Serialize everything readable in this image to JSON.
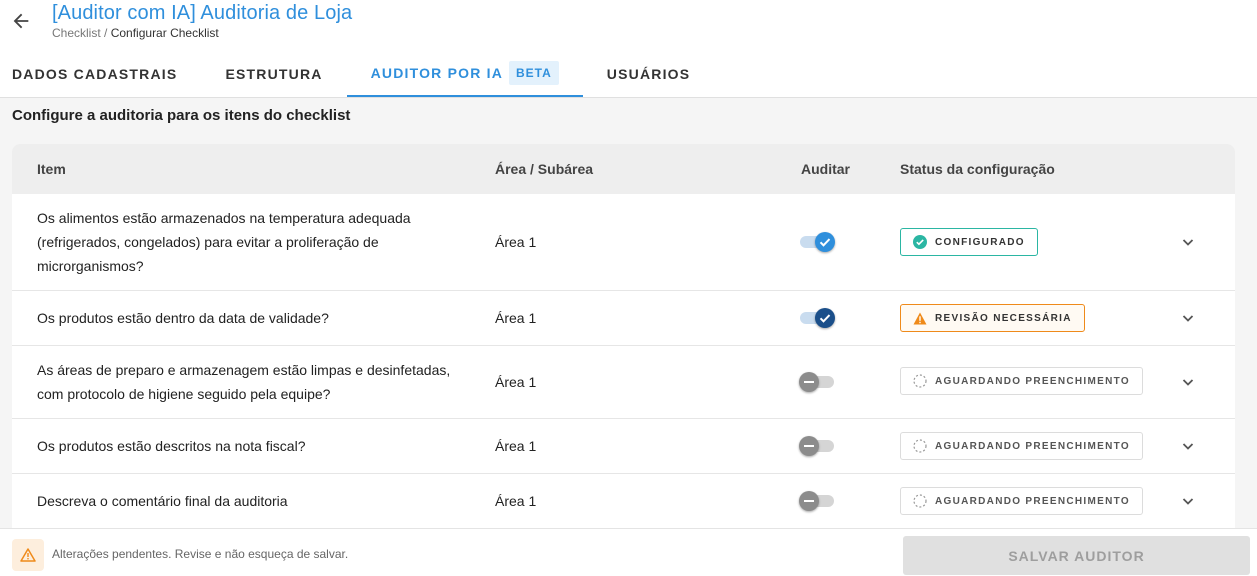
{
  "header": {
    "title": "[Auditor com IA] Auditoria de Loja",
    "breadcrumb_root": "Checklist",
    "breadcrumb_sep": " / ",
    "breadcrumb_current": "Configurar Checklist"
  },
  "tabs": [
    {
      "label": "DADOS CADASTRAIS"
    },
    {
      "label": "ESTRUTURA"
    },
    {
      "label": "AUDITOR POR IA",
      "badge": "BETA",
      "active": true
    },
    {
      "label": "USUÁRIOS"
    }
  ],
  "section_title": "Configure a auditoria para os itens do checklist",
  "table": {
    "headers": {
      "item": "Item",
      "area": "Área / Subárea",
      "audit": "Auditar",
      "status": "Status da configuração"
    },
    "rows": [
      {
        "item": "Os alimentos estão armazenados na temperatura adequada (refrigerados, congelados) para evitar a proliferação de microrganismos?",
        "area": "Área 1",
        "audit": true,
        "status": "CONFIGURADO"
      },
      {
        "item": "Os produtos estão dentro da data de validade?",
        "area": "Área 1",
        "audit": true,
        "status": "REVISÃO NECESSÁRIA"
      },
      {
        "item": "As áreas de preparo e armazenagem estão limpas e desinfetadas, com protocolo de higiene seguido pela equipe?",
        "area": "Área 1",
        "audit": false,
        "status": "AGUARDANDO PREENCHIMENTO"
      },
      {
        "item": "Os produtos estão descritos na nota fiscal?",
        "area": "Área 1",
        "audit": false,
        "status": "AGUARDANDO PREENCHIMENTO"
      },
      {
        "item": "Descreva o comentário final da auditoria",
        "area": "Área 1",
        "audit": false,
        "status": "AGUARDANDO PREENCHIMENTO"
      }
    ]
  },
  "footer": {
    "pending_message": "Alterações pendentes. Revise e não esqueça de salvar.",
    "save_label": "SALVAR AUDITOR"
  },
  "colors": {
    "accent": "#2f8fdc",
    "configured": "#2bb6a3",
    "warning": "#ef8a1a",
    "knob_blue": "#2f8fdc",
    "knob_navy": "#1b4f8a"
  }
}
